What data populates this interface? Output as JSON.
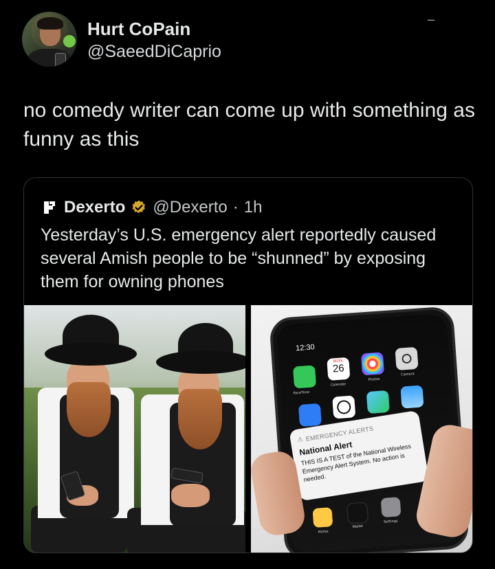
{
  "post": {
    "author_name": "Hurt CoPain",
    "author_handle": "@SaeedDiCaprio",
    "more_menu": "–",
    "text": "no comedy writer can come up with something as funny as this"
  },
  "quoted_post": {
    "author_name": "Dexerto",
    "author_handle": "@Dexerto",
    "separator": "·",
    "time_ago": "1h",
    "text": "Yesterday’s U.S. emergency alert reportedly caused several Amish people to be “shunned” by exposing them for owning phones"
  },
  "media_right": {
    "phone_time": "12:30",
    "calendar_day": "MON",
    "calendar_date": "26",
    "app_labels": {
      "facetime": "FaceTime",
      "calendar": "Calendar",
      "photos": "Photos",
      "camera": "Camera",
      "home": "Home",
      "wallet": "Wallet",
      "settings": "Settings"
    },
    "alert_header": "EMERGENCY ALERTS",
    "alert_title": "National Alert",
    "alert_body": "THIS IS A TEST of the National Wireless Emergency Alert System. No action is needed."
  },
  "colors": {
    "background": "#000000",
    "text": "#e7e9ea",
    "border": "#2f3336",
    "verified_gold": "#d8a52b"
  },
  "icons": {
    "verified": "verified-badge-icon",
    "dexerto_logo": "dexerto-logo-icon",
    "more": "more-icon"
  }
}
